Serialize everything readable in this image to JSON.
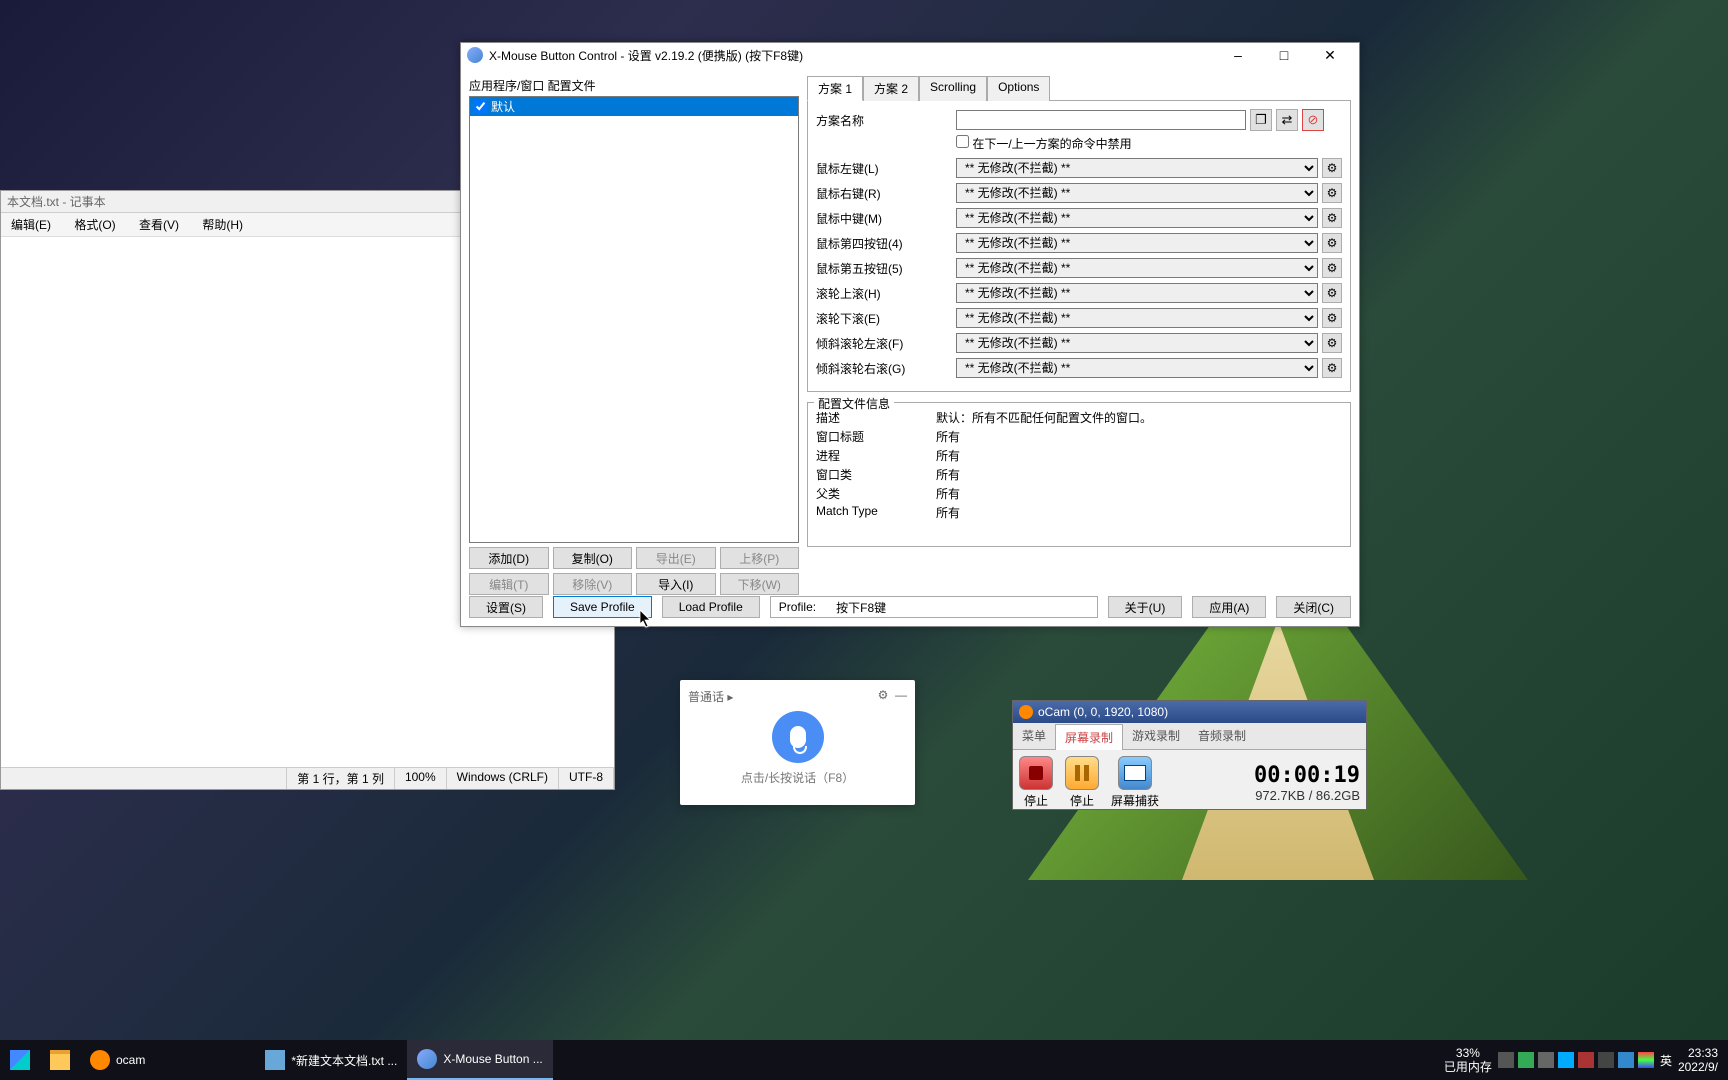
{
  "notepad": {
    "title": "本文档.txt - 记事本",
    "menu": {
      "edit": "编辑(E)",
      "format": "格式(O)",
      "view": "查看(V)",
      "help": "帮助(H)"
    },
    "status": {
      "pos": "第 1 行，第 1 列",
      "zoom": "100%",
      "eol": "Windows (CRLF)",
      "enc": "UTF-8"
    }
  },
  "xmbc": {
    "title": "X-Mouse Button Control - 设置 v2.19.2 (便携版) (按下F8键)",
    "left_label": "应用程序/窗口 配置文件",
    "default_profile": "默认",
    "buttons": {
      "add": "添加(D)",
      "copy": "复制(O)",
      "export": "导出(E)",
      "up": "上移(P)",
      "edit": "编辑(T)",
      "remove": "移除(V)",
      "import": "导入(I)",
      "down": "下移(W)"
    },
    "tabs": {
      "l1": "方案 1",
      "l2": "方案 2",
      "scroll": "Scrolling",
      "opts": "Options"
    },
    "name_label": "方案名称",
    "disable_label": "在下一/上一方案的命令中禁用",
    "rows": [
      {
        "label": "鼠标左键(L)",
        "value": "** 无修改(不拦截) **"
      },
      {
        "label": "鼠标右键(R)",
        "value": "** 无修改(不拦截) **"
      },
      {
        "label": "鼠标中键(M)",
        "value": "** 无修改(不拦截) **"
      },
      {
        "label": "鼠标第四按钮(4)",
        "value": "** 无修改(不拦截) **"
      },
      {
        "label": "鼠标第五按钮(5)",
        "value": "** 无修改(不拦截) **"
      },
      {
        "label": "滚轮上滚(H)",
        "value": "** 无修改(不拦截) **"
      },
      {
        "label": "滚轮下滚(E)",
        "value": "** 无修改(不拦截) **"
      },
      {
        "label": "倾斜滚轮左滚(F)",
        "value": "** 无修改(不拦截) **"
      },
      {
        "label": "倾斜滚轮右滚(G)",
        "value": "** 无修改(不拦截) **"
      }
    ],
    "info": {
      "legend": "配置文件信息",
      "desc_k": "描述",
      "desc_v": "默认：所有不匹配任何配置文件的窗口。",
      "wtitle_k": "窗口标题",
      "wtitle_v": "所有",
      "proc_k": "进程",
      "proc_v": "所有",
      "wclass_k": "窗口类",
      "wclass_v": "所有",
      "parent_k": "父类",
      "parent_v": "所有",
      "match_k": "Match Type",
      "match_v": "所有"
    },
    "bottom": {
      "settings": "设置(S)",
      "save": "Save Profile",
      "load": "Load Profile",
      "profile_lbl": "Profile:",
      "profile_val": "按下F8键",
      "about": "关于(U)",
      "apply": "应用(A)",
      "close": "关闭(C)"
    }
  },
  "speech": {
    "lang": "普通话",
    "hint": "点击/长按说话（F8）"
  },
  "ocam": {
    "title": "oCam (0, 0, 1920, 1080)",
    "tabs": {
      "menu": "菜单",
      "screen": "屏幕录制",
      "game": "游戏录制",
      "audio": "音频录制"
    },
    "btns": {
      "stop": "停止",
      "pause": "停止",
      "capture": "屏幕捕获"
    },
    "time": "00:00:19",
    "size": "972.7KB / 86.2GB"
  },
  "taskbar": {
    "items": {
      "ocam": "ocam",
      "notepad": "*新建文本文档.txt ...",
      "xmbc": "X-Mouse Button ..."
    },
    "mem_pct": "33%",
    "mem_lbl": "已用内存",
    "ime": "英",
    "time": "23:33",
    "date": "2022/9/"
  }
}
